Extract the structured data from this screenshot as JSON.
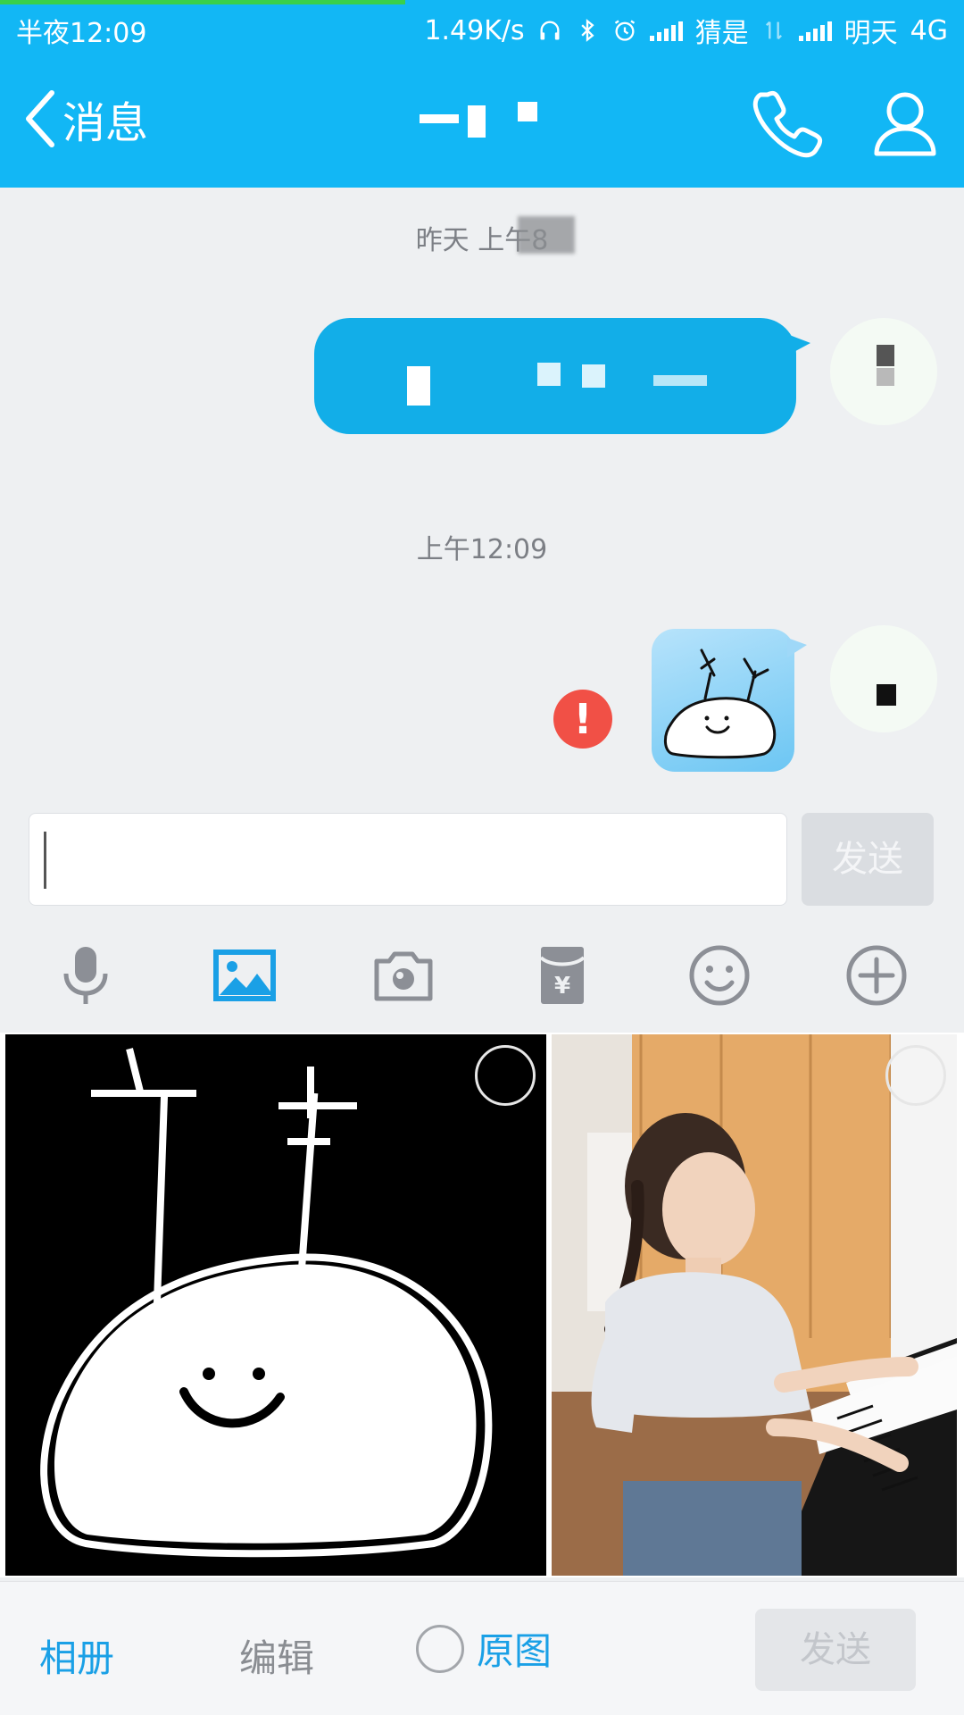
{
  "status_bar": {
    "time": "半夜12:09",
    "net_speed": "1.49K/s",
    "carrier1": "猜是",
    "carrier2": "明天",
    "network": "4G",
    "page_load_progress": 0.42
  },
  "header": {
    "back_label": "消息"
  },
  "chat": {
    "timestamp_1": "昨天 上午8",
    "timestamp_2": "上午12:09",
    "message_2_status": "!"
  },
  "input": {
    "value": "",
    "send_label": "发送"
  },
  "toolbar": {
    "items": [
      "microphone-icon",
      "image-icon",
      "camera-icon",
      "red-packet-icon",
      "emoji-icon",
      "plus-icon"
    ],
    "active": "image-icon",
    "active_color": "#1aa0e6",
    "inactive_color": "#8c8f96"
  },
  "bottom_bar": {
    "album_label": "相册",
    "edit_label": "编辑",
    "original_label": "原图",
    "send_label": "发送"
  },
  "colors": {
    "brand_blue": "#12b7f5",
    "error_red": "#f15046"
  }
}
